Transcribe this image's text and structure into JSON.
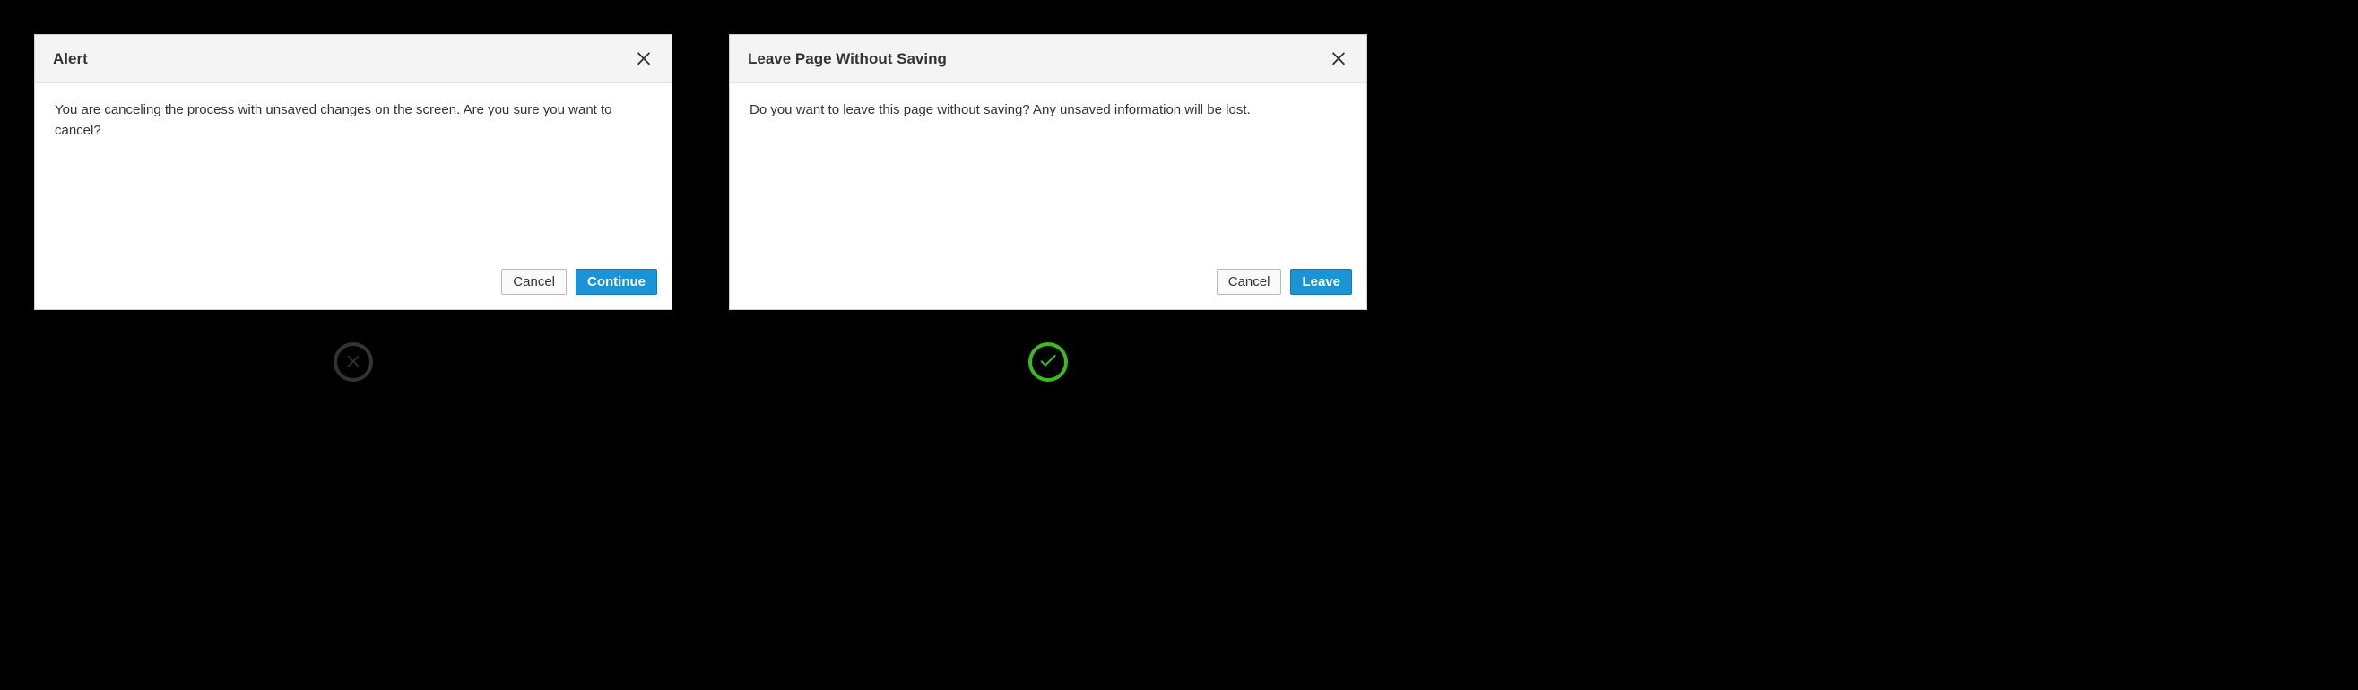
{
  "left": {
    "title": "Alert",
    "body": "You are canceling the process with unsaved changes on the screen. Are you sure you want to cancel?",
    "cancel_label": "Cancel",
    "primary_label": "Continue"
  },
  "right": {
    "title": "Leave Page Without Saving",
    "body": "Do you want to leave this page without saving? Any unsaved information will be lost.",
    "cancel_label": "Cancel",
    "primary_label": "Leave"
  }
}
